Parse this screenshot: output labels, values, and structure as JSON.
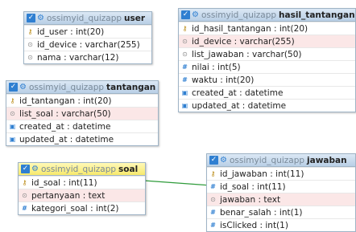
{
  "tables": {
    "user": {
      "db": "ossimyid_quizapp",
      "name": "user",
      "columns": [
        {
          "icon": "key-icon",
          "text": "id_user : int(20)"
        },
        {
          "icon": "string-icon",
          "text": "id_device : varchar(255)"
        },
        {
          "icon": "string-icon",
          "text": "nama : varchar(12)"
        }
      ]
    },
    "hasil_tantangan": {
      "db": "ossimyid_quizapp",
      "name": "hasil_tantangan",
      "columns": [
        {
          "icon": "key-icon",
          "text": "id_hasil_tantangan : int(20)"
        },
        {
          "icon": "string-icon",
          "text": "id_device : varchar(255)"
        },
        {
          "icon": "string-icon",
          "text": "list_jawaban : varchar(50)"
        },
        {
          "icon": "int-icon",
          "text": "nilai : int(5)"
        },
        {
          "icon": "int-icon",
          "text": "waktu : int(20)"
        },
        {
          "icon": "date-icon",
          "text": "created_at : datetime"
        },
        {
          "icon": "date-icon",
          "text": "updated_at : datetime"
        }
      ]
    },
    "tantangan": {
      "db": "ossimyid_quizapp",
      "name": "tantangan",
      "columns": [
        {
          "icon": "key-icon",
          "text": "id_tantangan : int(20)"
        },
        {
          "icon": "string-icon",
          "text": "list_soal : varchar(50)"
        },
        {
          "icon": "date-icon",
          "text": "created_at : datetime"
        },
        {
          "icon": "date-icon",
          "text": "updated_at : datetime"
        }
      ]
    },
    "soal": {
      "db": "ossimyid_quizapp",
      "name": "soal",
      "columns": [
        {
          "icon": "key-icon",
          "text": "id_soal : int(11)"
        },
        {
          "icon": "string-icon",
          "text": "pertanyaan : text"
        },
        {
          "icon": "int-icon",
          "text": "kategori_soal : int(2)"
        }
      ]
    },
    "jawaban": {
      "db": "ossimyid_quizapp",
      "name": "jawaban",
      "columns": [
        {
          "icon": "key-icon",
          "text": "id_jawaban : int(11)"
        },
        {
          "icon": "int-icon",
          "text": "id_soal : int(11)"
        },
        {
          "icon": "string-icon",
          "text": "jawaban : text"
        },
        {
          "icon": "int-icon",
          "text": "benar_salah : int(1)"
        },
        {
          "icon": "int-icon",
          "text": "isClicked : int(1)"
        }
      ]
    }
  },
  "colors": {
    "header": "#c8daee",
    "header_highlight": "#f7e96c",
    "relation_line": "#2e9b3a",
    "checkbox": "#2f7fd1"
  }
}
